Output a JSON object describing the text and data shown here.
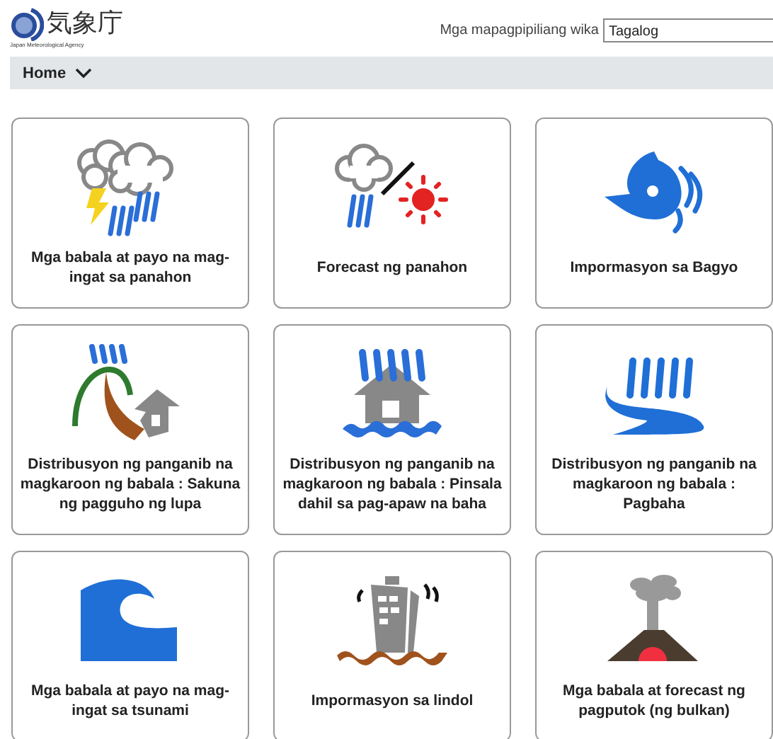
{
  "header": {
    "logo_text": "気象庁",
    "logo_subtitle": "Japan Meteorological Agency",
    "language_label": "Mga mapagpipiliang wika",
    "language_value": "Tagalog"
  },
  "nav": {
    "label": "Home"
  },
  "cards": [
    {
      "kind": "storm",
      "title": "Mga babala at payo na mag-ingat sa panahon"
    },
    {
      "kind": "forecast",
      "title": "Forecast ng panahon"
    },
    {
      "kind": "typhoon",
      "title": "Impormasyon sa Bagyo"
    },
    {
      "kind": "landslide",
      "title": "Distribusyon ng panganib na magkaroon ng babala : Sakuna ng pagguho ng lupa"
    },
    {
      "kind": "flood",
      "title": "Distribusyon ng panganib na magkaroon ng babala : Pinsala dahil sa pag-apaw na baha"
    },
    {
      "kind": "river",
      "title": "Distribusyon ng panganib na magkaroon ng babala : Pagbaha"
    },
    {
      "kind": "tsunami",
      "title": "Mga babala at payo na mag-ingat sa tsunami"
    },
    {
      "kind": "earthquake",
      "title": "Impormasyon sa lindol"
    },
    {
      "kind": "volcano",
      "title": "Mga babala at forecast ng pagputok (ng bulkan)"
    }
  ]
}
